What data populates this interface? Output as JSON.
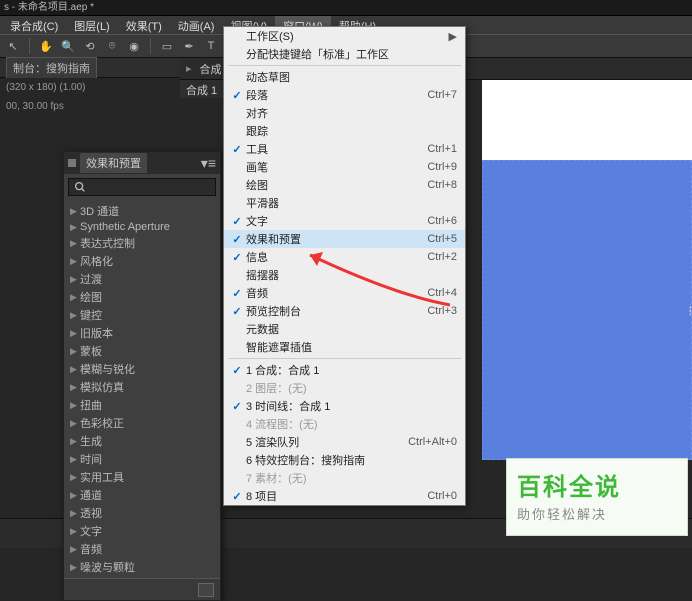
{
  "title": "s - 未命名项目.aep *",
  "menubar": [
    "录合成(C)",
    "图层(L)",
    "效果(T)",
    "动画(A)",
    "视图(V)",
    "窗口(W)",
    "帮助(H)"
  ],
  "menubar_active_index": 5,
  "toolbar_icons": [
    "pointer",
    "hand",
    "zoom",
    "rotate",
    "camera",
    "pan-behind",
    "shapes",
    "pen",
    "text",
    "brush",
    "stamp",
    "eraser",
    "roto",
    "puppet"
  ],
  "project_tab": "制台：搜狗指南",
  "composition_info_1": "(320 x 180) (1.00)",
  "composition_info_2": "00, 30.00 fps",
  "comp_panel_label": "合成：合",
  "comp_tab": "合成 1",
  "dropdown": {
    "sections": [
      [
        {
          "label": "工作区(S)",
          "arrow": true
        },
        {
          "label": "分配快捷键给「标准」工作区"
        }
      ],
      [
        {
          "label": "动态草图"
        },
        {
          "check": true,
          "label": "段落",
          "accel": "Ctrl+7"
        },
        {
          "label": "对齐"
        },
        {
          "label": "跟踪"
        },
        {
          "check": true,
          "label": "工具",
          "accel": "Ctrl+1"
        },
        {
          "label": "画笔",
          "accel": "Ctrl+9"
        },
        {
          "label": "绘图",
          "accel": "Ctrl+8"
        },
        {
          "label": "平滑器"
        },
        {
          "check": true,
          "label": "文字",
          "accel": "Ctrl+6"
        },
        {
          "check": true,
          "label": "效果和预置",
          "accel": "Ctrl+5",
          "hl": true
        },
        {
          "check": true,
          "label": "信息",
          "accel": "Ctrl+2"
        },
        {
          "label": "摇摆器"
        },
        {
          "check": true,
          "label": "音频",
          "accel": "Ctrl+4"
        },
        {
          "check": true,
          "label": "预览控制台",
          "accel": "Ctrl+3"
        },
        {
          "label": "元数据"
        },
        {
          "label": "智能遮罩插值"
        }
      ],
      [
        {
          "check": true,
          "label": "1 合成：合成 1"
        },
        {
          "label": "2 图层：(无)",
          "disabled": true
        },
        {
          "check": true,
          "label": "3 时间线：合成 1"
        },
        {
          "label": "4 流程图：(无)",
          "disabled": true
        },
        {
          "label": "5 渲染队列",
          "accel": "Ctrl+Alt+0"
        },
        {
          "label": "6 特效控制台：搜狗指南"
        },
        {
          "label": "7 素材：(无)",
          "disabled": true
        },
        {
          "check": true,
          "label": "8 项目",
          "accel": "Ctrl+0"
        }
      ]
    ]
  },
  "fx_panel": {
    "title": "效果和预置",
    "search_placeholder": "",
    "categories": [
      "3D 通道",
      "Synthetic Aperture",
      "表达式控制",
      "风格化",
      "过渡",
      "绘图",
      "键控",
      "旧版本",
      "蒙板",
      "模糊与锐化",
      "模拟仿真",
      "扭曲",
      "色彩校正",
      "生成",
      "时间",
      "实用工具",
      "通道",
      "透视",
      "文字",
      "音频",
      "噪波与颗粒"
    ]
  },
  "canvas_text": "搜狗",
  "badge": {
    "title": "百科全说",
    "sub": "助你轻松解决"
  }
}
